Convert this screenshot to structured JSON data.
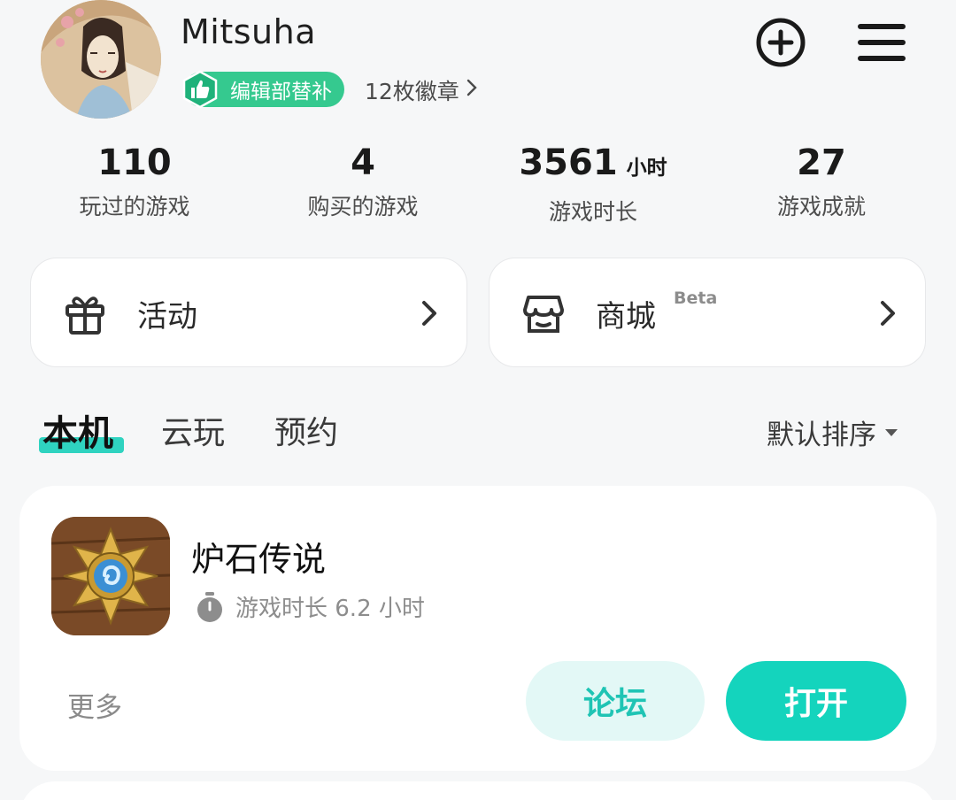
{
  "profile": {
    "username": "Mitsuha",
    "title_badge": "编辑部替补",
    "badge_count": "12枚徽章",
    "colors": {
      "badge_green": "#35c98f"
    }
  },
  "header_icons": [
    "plus-circle-icon",
    "menu-icon"
  ],
  "stats": [
    {
      "value": "110",
      "unit": "",
      "label": "玩过的游戏"
    },
    {
      "value": "4",
      "unit": "",
      "label": "购买的游戏"
    },
    {
      "value": "3561",
      "unit": "小时",
      "label": "游戏时长"
    },
    {
      "value": "27",
      "unit": "",
      "label": "游戏成就"
    }
  ],
  "quick_links": {
    "events": {
      "label": "活动",
      "icon": "gift-icon"
    },
    "store": {
      "label": "商城",
      "tag": "Beta",
      "icon": "store-icon"
    }
  },
  "tabs": {
    "local": "本机",
    "cloud": "云玩",
    "reserve": "预约",
    "sort_label": "默认排序"
  },
  "games": [
    {
      "title": "炉石传说",
      "playtime": "游戏时长 6.2 小时",
      "more_label": "更多",
      "forum_label": "论坛",
      "open_label": "打开"
    }
  ],
  "theme": {
    "accent": "#14d4bd",
    "accent_light": "#e3f8f6"
  }
}
